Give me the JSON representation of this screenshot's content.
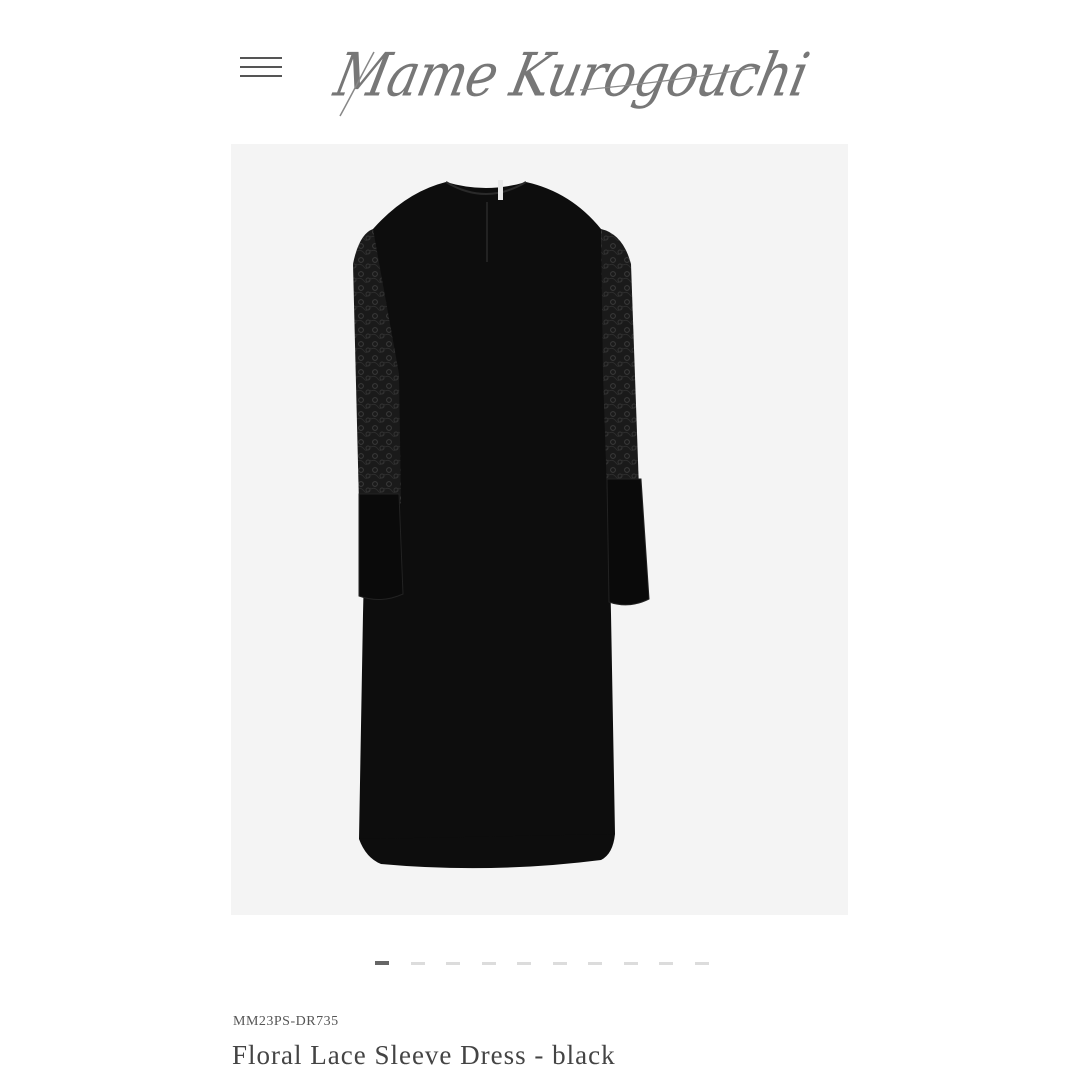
{
  "header": {
    "menu_icon": "hamburger-menu-icon",
    "brand_logo": "Mame Kurogouchi"
  },
  "product": {
    "image_alt": "Floral Lace Sleeve Dress - black",
    "sku": "MM23PS-DR735",
    "name": "Floral Lace Sleeve Dress - black"
  },
  "carousel": {
    "total": 10,
    "active_index": 0
  },
  "colors": {
    "background": "#ffffff",
    "image_bg": "#f4f4f4",
    "dress": "#0d0d0d",
    "text": "#444444",
    "active_dot": "#666666",
    "inactive_dot": "#dcdcdc"
  }
}
